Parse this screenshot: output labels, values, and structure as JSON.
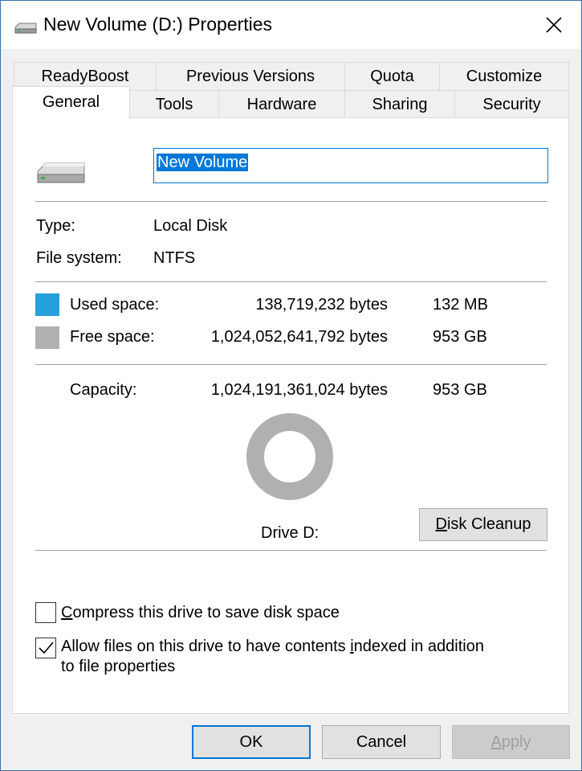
{
  "window": {
    "title": "New Volume (D:) Properties"
  },
  "tabs": {
    "row1": [
      "ReadyBoost",
      "Previous Versions",
      "Quota",
      "Customize"
    ],
    "row2": [
      "General",
      "Tools",
      "Hardware",
      "Sharing",
      "Security"
    ],
    "active": "General"
  },
  "general": {
    "volume_name": "New Volume",
    "type_label": "Type:",
    "type_value": "Local Disk",
    "fs_label": "File system:",
    "fs_value": "NTFS",
    "used_label": "Used space:",
    "used_bytes": "138,719,232 bytes",
    "used_size": "132 MB",
    "free_label": "Free space:",
    "free_bytes": "1,024,052,641,792 bytes",
    "free_size": "953 GB",
    "capacity_label": "Capacity:",
    "capacity_bytes": "1,024,191,361,024 bytes",
    "capacity_size": "953 GB",
    "drive_label": "Drive D:",
    "used_fraction": 0.000135,
    "colors": {
      "used": "#26a0da",
      "free": "#b0b0b0"
    }
  },
  "buttons": {
    "disk_cleanup_prefix": "D",
    "disk_cleanup_rest": "isk Cleanup",
    "ok": "OK",
    "cancel": "Cancel",
    "apply_prefix": "A",
    "apply_rest": "pply"
  },
  "options": {
    "compress_prefix": "C",
    "compress_rest": "ompress this drive to save disk space",
    "compress_checked": false,
    "index_line1_a": "Allow files on this drive to have contents ",
    "index_line1_u": "i",
    "index_line1_b": "ndexed in addition",
    "index_line2": "to file properties",
    "index_checked": true
  }
}
